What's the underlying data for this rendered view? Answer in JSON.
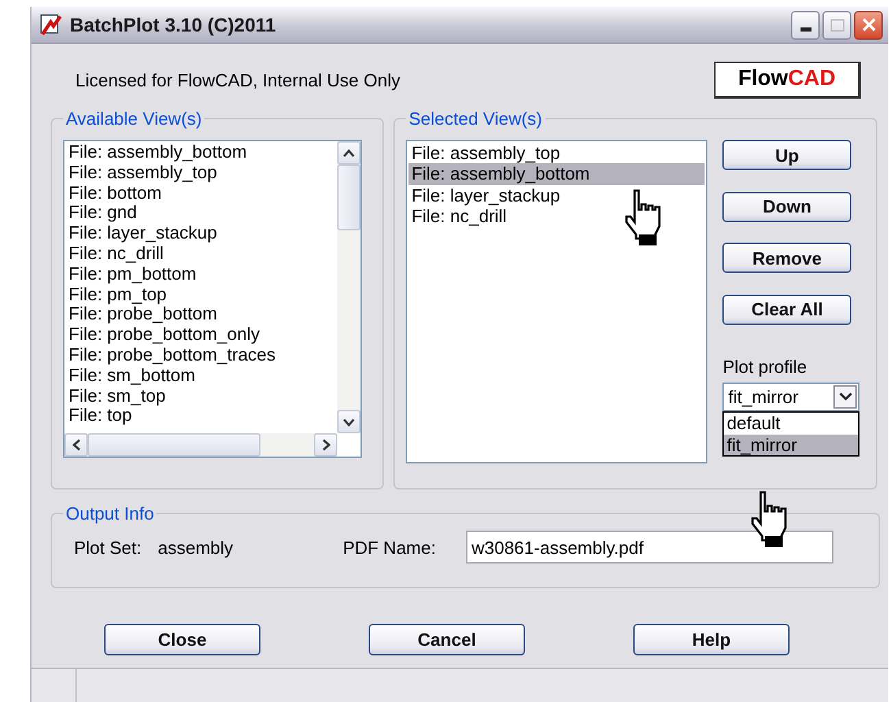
{
  "window": {
    "title": "BatchPlot 3.10 (C)2011"
  },
  "license": "Licensed for FlowCAD, Internal Use Only",
  "logo": {
    "prefix": "Flow",
    "accent": "CAD"
  },
  "available": {
    "title": "Available View(s)",
    "items": [
      "File: assembly_bottom",
      "File: assembly_top",
      "File: bottom",
      "File: gnd",
      "File: layer_stackup",
      "File: nc_drill",
      "File: pm_bottom",
      "File: pm_top",
      "File: probe_bottom",
      "File: probe_bottom_only",
      "File: probe_bottom_traces",
      "File: sm_bottom",
      "File: sm_top",
      "File: top"
    ]
  },
  "selected": {
    "title": "Selected View(s)",
    "items": [
      {
        "label": "File: assembly_top",
        "selected": false
      },
      {
        "label": "File: assembly_bottom",
        "selected": true
      },
      {
        "label": "File: layer_stackup",
        "selected": false
      },
      {
        "label": "File: nc_drill",
        "selected": false
      }
    ]
  },
  "actions": [
    "Up",
    "Down",
    "Remove",
    "Clear All"
  ],
  "plot_profile": {
    "label": "Plot profile",
    "value": "fit_mirror",
    "expanded": true,
    "options": [
      {
        "label": "default",
        "selected": false
      },
      {
        "label": "fit_mirror",
        "selected": true
      }
    ]
  },
  "output": {
    "title": "Output Info",
    "plot_set_label": "Plot Set:",
    "plot_set": "assembly",
    "pdf_label": "PDF Name:",
    "pdf_name": "w30861-assembly.pdf"
  },
  "buttons": [
    "Close",
    "Cancel",
    "Help"
  ]
}
